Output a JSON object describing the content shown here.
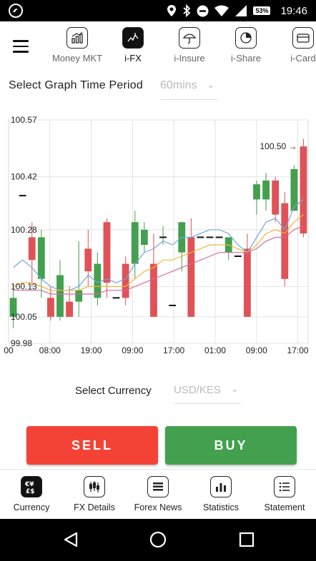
{
  "status_bar": {
    "battery": "53%",
    "time": "19:46"
  },
  "top_nav": {
    "items": [
      {
        "label": "Money MKT",
        "icon": "money-market-icon",
        "active": false
      },
      {
        "label": "i-FX",
        "icon": "fx-chart-icon",
        "active": true
      },
      {
        "label": "i-Insure",
        "icon": "umbrella-icon",
        "active": false
      },
      {
        "label": "i-Share",
        "icon": "pie-chart-icon",
        "active": false
      },
      {
        "label": "i-Card",
        "icon": "card-icon",
        "active": false
      }
    ]
  },
  "period": {
    "label": "Select Graph Time Period",
    "value": "60mins"
  },
  "currency": {
    "label": "Select Currency",
    "value": "USD/KES"
  },
  "actions": {
    "sell": "SELL",
    "buy": "BUY"
  },
  "bottom_nav": {
    "items": [
      {
        "label": "Currency",
        "icon": "currency-icon",
        "active": true
      },
      {
        "label": "FX Details",
        "icon": "candlestick-icon",
        "active": false
      },
      {
        "label": "Forex News",
        "icon": "news-icon",
        "active": false
      },
      {
        "label": "Statistics",
        "icon": "bar-chart-icon",
        "active": false
      },
      {
        "label": "Statement",
        "icon": "list-icon",
        "active": false
      }
    ]
  },
  "colors": {
    "up": "#43a04e",
    "down": "#e05257",
    "sell": "#f44336",
    "buy": "#43a04e",
    "ma_blue": "#6fa8dc",
    "ma_orange": "#f1b43a",
    "ma_pink": "#d56ba0"
  },
  "chart_data": {
    "type": "candlestick",
    "ylim": [
      99.98,
      100.57
    ],
    "y_ticks": [
      "100.57",
      "100.42",
      "100.28",
      "100.13",
      "100.05",
      "99.98"
    ],
    "x_ticks": [
      "00",
      "08:00",
      "19:00",
      "09:00",
      "17:00",
      "01:00",
      "09:00",
      "17:00"
    ],
    "last_price_label": "100.50",
    "candles": [
      {
        "o": 100.05,
        "c": 100.1,
        "h": 100.13,
        "l": 100.02
      },
      {
        "o": 100.37,
        "c": 100.37,
        "h": 100.37,
        "l": 100.37
      },
      {
        "o": 100.26,
        "c": 100.2,
        "h": 100.3,
        "l": 100.13
      },
      {
        "o": 100.15,
        "c": 100.26,
        "h": 100.28,
        "l": 100.1
      },
      {
        "o": 100.1,
        "c": 100.05,
        "h": 100.13,
        "l": 100.04
      },
      {
        "o": 100.05,
        "c": 100.16,
        "h": 100.2,
        "l": 100.04
      },
      {
        "o": 100.09,
        "c": 100.05,
        "h": 100.13,
        "l": 100.05
      },
      {
        "o": 100.09,
        "c": 100.12,
        "h": 100.25,
        "l": 100.05
      },
      {
        "o": 100.23,
        "c": 100.17,
        "h": 100.28,
        "l": 100.13
      },
      {
        "o": 100.1,
        "c": 100.19,
        "h": 100.22,
        "l": 100.08
      },
      {
        "o": 100.3,
        "c": 100.14,
        "h": 100.31,
        "l": 100.1
      },
      {
        "o": 100.1,
        "c": 100.1,
        "h": 100.1,
        "l": 100.1
      },
      {
        "o": 100.19,
        "c": 100.1,
        "h": 100.21,
        "l": 100.08
      },
      {
        "o": 100.19,
        "c": 100.3,
        "h": 100.33,
        "l": 100.15
      },
      {
        "o": 100.24,
        "c": 100.28,
        "h": 100.3,
        "l": 100.22
      },
      {
        "o": 100.19,
        "c": 100.05,
        "h": 100.27,
        "l": 100.05
      },
      {
        "o": 100.26,
        "c": 100.26,
        "h": 100.29,
        "l": 100.24
      },
      {
        "o": 100.08,
        "c": 100.08,
        "h": 100.08,
        "l": 100.08
      },
      {
        "o": 100.22,
        "c": 100.3,
        "h": 100.3,
        "l": 100.17
      },
      {
        "o": 100.26,
        "c": 100.05,
        "h": 100.31,
        "l": 100.05
      },
      {
        "o": 100.26,
        "c": 100.26,
        "h": 100.26,
        "l": 100.26
      },
      {
        "o": 100.26,
        "c": 100.26,
        "h": 100.26,
        "l": 100.26
      },
      {
        "o": 100.26,
        "c": 100.26,
        "h": 100.26,
        "l": 100.26
      },
      {
        "o": 100.22,
        "c": 100.26,
        "h": 100.26,
        "l": 100.2
      },
      {
        "o": 100.21,
        "c": 100.21,
        "h": 100.21,
        "l": 100.21
      },
      {
        "o": 100.23,
        "c": 100.05,
        "h": 100.27,
        "l": 100.05
      },
      {
        "o": 100.36,
        "c": 100.4,
        "h": 100.41,
        "l": 100.32
      },
      {
        "o": 100.36,
        "c": 100.41,
        "h": 100.43,
        "l": 100.33
      },
      {
        "o": 100.41,
        "c": 100.32,
        "h": 100.42,
        "l": 100.3
      },
      {
        "o": 100.35,
        "c": 100.15,
        "h": 100.38,
        "l": 100.13
      },
      {
        "o": 100.33,
        "c": 100.44,
        "h": 100.45,
        "l": 100.33
      },
      {
        "o": 100.5,
        "c": 100.27,
        "h": 100.52,
        "l": 100.26
      }
    ],
    "series": [
      {
        "values": [
          100.18,
          100.2,
          100.18,
          100.15,
          100.13,
          100.12,
          100.12,
          100.13,
          100.16,
          100.14,
          100.15,
          100.14,
          100.15,
          100.19,
          100.22,
          100.23,
          100.25,
          100.24,
          100.26,
          100.26,
          100.27,
          100.28,
          100.28,
          100.27,
          100.24,
          100.22,
          100.26,
          100.3,
          100.31,
          100.28,
          100.34,
          100.36
        ]
      },
      {
        "values": [
          100.13,
          100.14,
          100.14,
          100.13,
          100.12,
          100.12,
          100.12,
          100.12,
          100.13,
          100.13,
          100.13,
          100.13,
          100.13,
          100.15,
          100.17,
          100.18,
          100.2,
          100.2,
          100.21,
          100.22,
          100.23,
          100.24,
          100.24,
          100.24,
          100.23,
          100.22,
          100.24,
          100.27,
          100.28,
          100.27,
          100.3,
          100.32
        ]
      },
      {
        "values": [
          100.12,
          100.12,
          100.12,
          100.12,
          100.11,
          100.11,
          100.11,
          100.11,
          100.11,
          100.11,
          100.12,
          100.12,
          100.12,
          100.13,
          100.14,
          100.15,
          100.16,
          100.17,
          100.18,
          100.19,
          100.2,
          100.21,
          100.22,
          100.22,
          100.22,
          100.22,
          100.23,
          100.25,
          100.26,
          100.26,
          100.28,
          100.29
        ]
      }
    ]
  }
}
